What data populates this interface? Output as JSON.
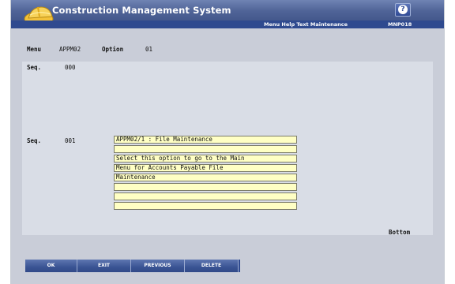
{
  "app": {
    "title": "Construction Management System",
    "screen_title": "Menu Help Text Maintenance",
    "screen_code": "MNP018",
    "help_symbol": "?"
  },
  "header": {
    "menu_label": "Menu",
    "menu_value": "APPM02",
    "option_label": "Option",
    "option_value": "01"
  },
  "sequences": [
    {
      "label": "Seq.",
      "value": "000"
    },
    {
      "label": "Seq.",
      "value": "001"
    }
  ],
  "help_lines": [
    "APPM02/1 : File Maintenance",
    "",
    "Select this option to go to the Main",
    "Menu for Accounts Payable File",
    "Maintenance",
    "",
    "",
    ""
  ],
  "status": {
    "bottom": "Bottom"
  },
  "buttons": {
    "ok": "OK",
    "exit": "EXIT",
    "previous": "PREVIOUS",
    "delete": "DELETE"
  },
  "colors": {
    "title_bar": "#4f6397",
    "sub_bar": "#2f4a8f",
    "field_bg": "#ffffc4",
    "window_bg": "#c9cdd8"
  }
}
